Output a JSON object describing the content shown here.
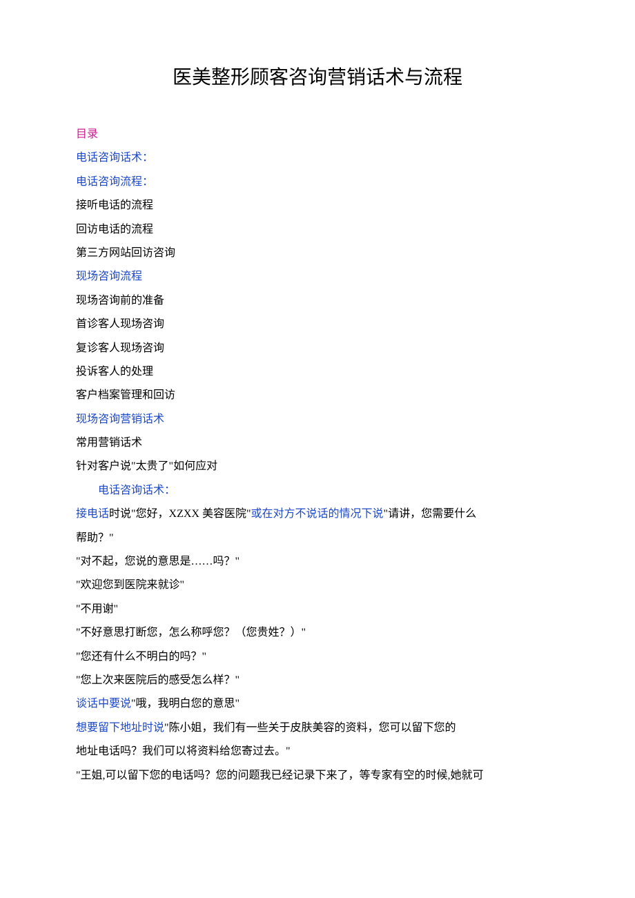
{
  "title": "医美整形顾客咨询营销话术与流程",
  "toc": {
    "label": "目录",
    "items": [
      {
        "text": "电话咨询话术：",
        "color": "blue"
      },
      {
        "text": "电话咨询流程：",
        "color": "blue"
      },
      {
        "text": "接听电话的流程",
        "color": "black"
      },
      {
        "text": "回访电话的流程",
        "color": "black"
      },
      {
        "text": "第三方网站回访咨询",
        "color": "black"
      },
      {
        "text": "现场咨询流程",
        "color": "blue"
      },
      {
        "text": "现场咨询前的准备",
        "color": "black"
      },
      {
        "text": "首诊客人现场咨询",
        "color": "black"
      },
      {
        "text": "复诊客人现场咨询",
        "color": "black"
      },
      {
        "text": "投诉客人的处理",
        "color": "black"
      },
      {
        "text": "客户档案管理和回访",
        "color": "black"
      },
      {
        "text": "现场咨询营销话术",
        "color": "blue"
      },
      {
        "text": "常用营销话术",
        "color": "black"
      },
      {
        "text": "针对客户说\"太贵了\"如何应对",
        "color": "black"
      }
    ]
  },
  "section1": {
    "heading": "电话咨询话术：",
    "phone_prefix": "接电话",
    "phone_mid1": "时说\"您好，XZXX 美容医院\"",
    "phone_cond": "或在对方不说话的情况下说",
    "phone_mid2": "\"请讲，您需要什么",
    "phone_line2": "帮助？\"",
    "q1": "\"对不起，您说的意思是……吗？\"",
    "q2": "\"欢迎您到医院来就诊\"",
    "q3": "\"不用谢\"",
    "q4": "\"不好意思打断您，怎么称呼您？（您贵姓？）\"",
    "q5": "\"您还有什么不明白的吗？\"",
    "q6": "\"您上次来医院后的感受怎么样？\"",
    "talk_prefix": "谈话中要说",
    "talk_text": "\"哦，我明白您的意思\"",
    "addr_prefix": "想要留下地址时说",
    "addr_text": "\"陈小姐，我们有一些关于皮肤美容的资料，您可以留下您的",
    "addr_line2": "地址电话吗？我们可以将资料给您寄过去。\"",
    "wang": "\"王姐,可以留下您的电话吗？您的问题我已经记录下来了，等专家有空的时候,她就可"
  }
}
